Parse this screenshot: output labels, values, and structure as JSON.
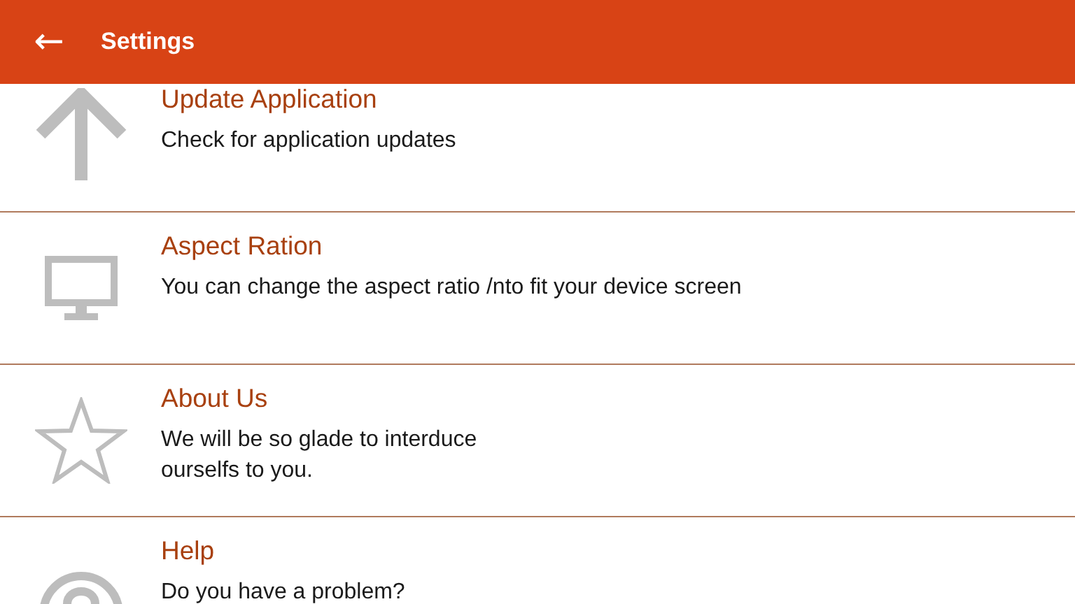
{
  "app_bar": {
    "back_icon": "←",
    "title": "Settings"
  },
  "items": [
    {
      "kind": "update",
      "title": "Update Application",
      "description": [
        "Check for application updates"
      ]
    },
    {
      "kind": "display",
      "title": "Aspect Ration",
      "description": [
        "You can change the aspect ratio /nto fit your device screen"
      ]
    },
    {
      "kind": "about",
      "title": "About Us",
      "description": [
        "We will be so glade to interduce",
        "ourselfs to you."
      ]
    },
    {
      "kind": "help",
      "title": "Help",
      "description": [
        "Do you have a problem?"
      ]
    }
  ]
}
